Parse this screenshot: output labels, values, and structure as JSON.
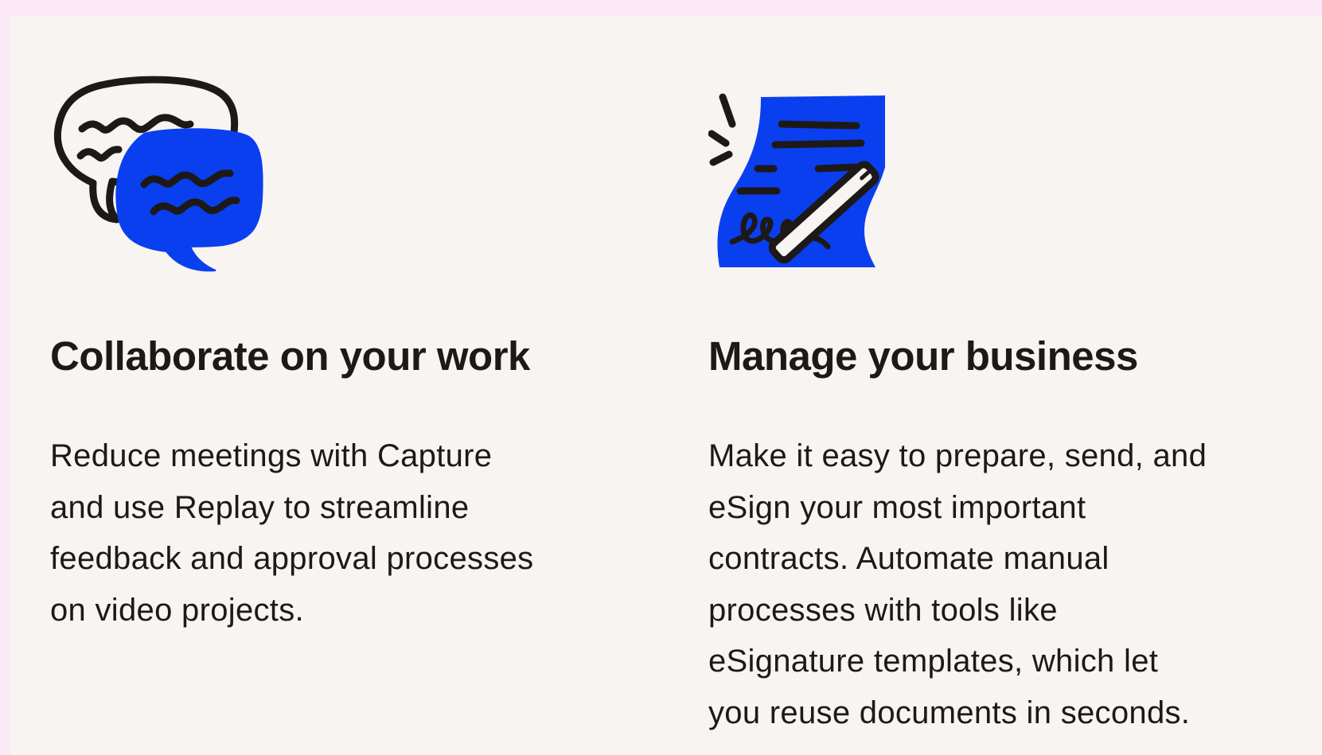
{
  "colors": {
    "page_background": "#fde8f8",
    "panel_background": "#f7f4f1",
    "text": "#1e1919",
    "accent_blue": "#0a3ff0",
    "ink": "#1e1919"
  },
  "cards": [
    {
      "icon": "chat-bubbles-icon",
      "title": "Collaborate on your work",
      "body_lines": [
        "Reduce meetings with Capture",
        "and use Replay to streamline",
        "feedback and approval processes",
        "on video projects."
      ]
    },
    {
      "icon": "signed-document-icon",
      "title": "Manage your business",
      "body_lines": [
        "Make it easy to prepare, send, and",
        "eSign your most important",
        "contracts. Automate manual",
        "processes with tools like",
        "eSignature templates, which let",
        "you reuse documents in seconds."
      ]
    }
  ]
}
